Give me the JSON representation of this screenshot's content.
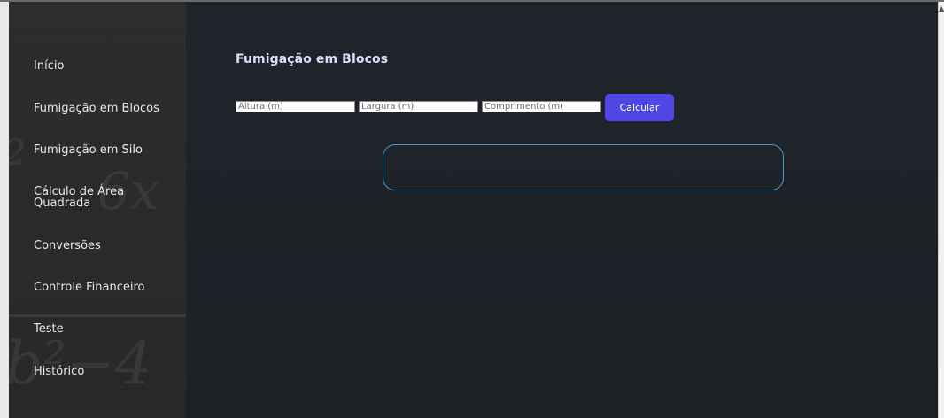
{
  "sidebar": {
    "items": [
      {
        "label": "Início"
      },
      {
        "label": "Fumigação em Blocos"
      },
      {
        "label": "Fumigação em Silo"
      },
      {
        "label": "Cálculo de Área Quadrada"
      },
      {
        "label": "Conversões"
      },
      {
        "label": "Controle Financeiro"
      },
      {
        "label": "Teste"
      },
      {
        "label": "Histórico"
      }
    ]
  },
  "main": {
    "title": "Fumigação em Blocos",
    "inputs": {
      "altura_placeholder": "Altura (m)",
      "largura_placeholder": "Largura (m)",
      "comprimento_placeholder": "Comprimento (m)",
      "altura_value": "",
      "largura_value": "",
      "comprimento_value": ""
    },
    "calculate_label": "Calcular",
    "result_text": ""
  },
  "colors": {
    "accent": "#4f46e5",
    "result_border": "#3aa0d6",
    "title": "#dcdcff",
    "sidebar_bg": "#2d2b29",
    "main_bg": "#1f242a"
  }
}
